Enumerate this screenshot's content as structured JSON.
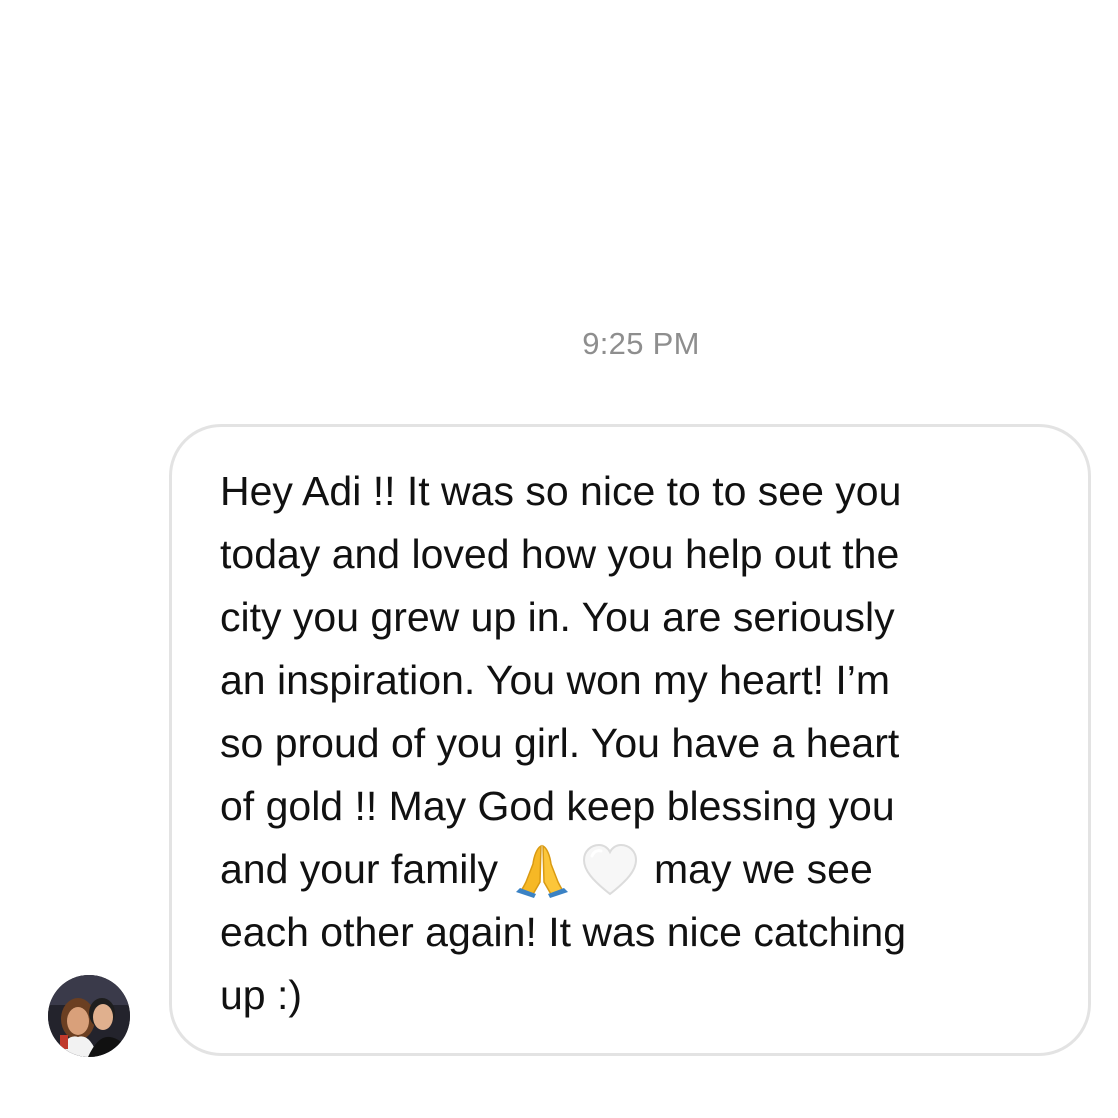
{
  "conversation": {
    "timestamp": "9:25 PM",
    "sender_avatar": {
      "icon": "avatar-photo"
    },
    "message": {
      "lines": [
        "Hey Adi !! It was so nice to to see you",
        "today and loved how you help out the",
        "city you grew up in. You are seriously",
        "an inspiration. You won my heart! I’m",
        "so proud of you girl. You have a heart",
        "of gold !! May God keep blessing you"
      ],
      "emoji_line": {
        "before": "and your family",
        "emojis": [
          "folded-hands-icon",
          "white-heart-icon"
        ],
        "after": "may we see"
      },
      "lines_end": [
        "each other again! It was nice catching",
        "up :)"
      ]
    },
    "colors": {
      "timestamp": "#8e8e8e",
      "bubble_border": "#e3e3e3",
      "text": "#111111",
      "background": "#ffffff"
    }
  }
}
